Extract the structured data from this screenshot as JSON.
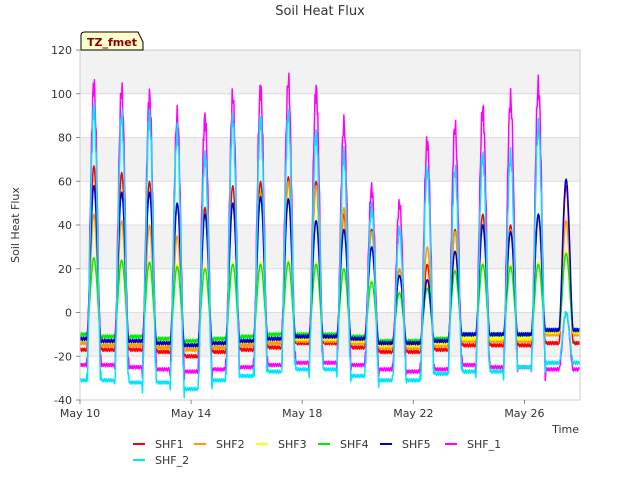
{
  "chart_data": {
    "type": "line",
    "title": "Soil Heat Flux",
    "xlabel": "Time",
    "ylabel": "Soil Heat Flux",
    "badge": "TZ_fmet",
    "xlim": [
      "2025-05-10",
      "2025-05-28"
    ],
    "ylim": [
      -40,
      120
    ],
    "yticks": [
      -40,
      -20,
      0,
      20,
      40,
      60,
      80,
      100,
      120
    ],
    "xticks": [
      {
        "date": "2025-05-10",
        "label": "May 10"
      },
      {
        "date": "2025-05-14",
        "label": "May 14"
      },
      {
        "date": "2025-05-18",
        "label": "May 18"
      },
      {
        "date": "2025-05-22",
        "label": "May 22"
      },
      {
        "date": "2025-05-26",
        "label": "May 26"
      }
    ],
    "grid": true,
    "legend_position": "bottom",
    "days": [
      "2025-05-10",
      "2025-05-11",
      "2025-05-12",
      "2025-05-13",
      "2025-05-14",
      "2025-05-15",
      "2025-05-16",
      "2025-05-17",
      "2025-05-18",
      "2025-05-19",
      "2025-05-20",
      "2025-05-21",
      "2025-05-22",
      "2025-05-23",
      "2025-05-24",
      "2025-05-25",
      "2025-05-26",
      "2025-05-27"
    ],
    "series": [
      {
        "name": "SHF1",
        "color": "#ff0000",
        "daily_max": [
          67,
          64,
          60,
          50,
          48,
          58,
          60,
          62,
          60,
          45,
          38,
          20,
          22,
          38,
          45,
          40,
          45,
          58
        ],
        "daily_min": [
          -17,
          -17,
          -17,
          -18,
          -20,
          -18,
          -17,
          -16,
          -14,
          -14,
          -16,
          -18,
          -18,
          -17,
          -15,
          -15,
          -15,
          -14
        ]
      },
      {
        "name": "SHF2",
        "color": "#ff9900",
        "daily_max": [
          45,
          42,
          40,
          35,
          45,
          50,
          55,
          60,
          58,
          48,
          37,
          20,
          30,
          37,
          40,
          38,
          43,
          42
        ],
        "daily_min": [
          -14,
          -15,
          -15,
          -16,
          -17,
          -16,
          -15,
          -14,
          -13,
          -13,
          -14,
          -16,
          -16,
          -15,
          -13,
          -13,
          -13,
          -10
        ]
      },
      {
        "name": "SHF3",
        "color": "#ffff00",
        "daily_max": [
          25,
          24,
          23,
          22,
          21,
          23,
          23,
          24,
          23,
          20,
          15,
          10,
          12,
          20,
          23,
          22,
          23,
          28
        ],
        "daily_min": [
          -12,
          -13,
          -13,
          -14,
          -15,
          -14,
          -13,
          -12,
          -12,
          -12,
          -13,
          -15,
          -15,
          -14,
          -12,
          -12,
          -12,
          -9
        ]
      },
      {
        "name": "SHF4",
        "color": "#00ee00",
        "daily_max": [
          25,
          24,
          23,
          21,
          20,
          22,
          22,
          23,
          22,
          20,
          14,
          9,
          11,
          19,
          22,
          21,
          22,
          27
        ],
        "daily_min": [
          -10,
          -11,
          -11,
          -12,
          -13,
          -12,
          -11,
          -10,
          -10,
          -10,
          -11,
          -13,
          -13,
          -12,
          -10,
          -10,
          -10,
          -8
        ]
      },
      {
        "name": "SHF5",
        "color": "#0000cc",
        "daily_max": [
          58,
          55,
          55,
          50,
          45,
          50,
          53,
          52,
          42,
          38,
          30,
          17,
          15,
          28,
          40,
          37,
          45,
          61
        ],
        "daily_min": [
          -12,
          -13,
          -13,
          -14,
          -15,
          -14,
          -13,
          -12,
          -11,
          -11,
          -12,
          -14,
          -14,
          -13,
          -10,
          -10,
          -10,
          -8
        ]
      },
      {
        "name": "SHF_1",
        "color": "#ff00ff",
        "daily_max": [
          104,
          102,
          99,
          90,
          89,
          99,
          102,
          106,
          102,
          86,
          57,
          50,
          78,
          85,
          93,
          98,
          104,
          0
        ],
        "daily_min": [
          -24,
          -24,
          -25,
          -26,
          -27,
          -26,
          -25,
          -24,
          -23,
          -23,
          -24,
          -26,
          -27,
          -26,
          -24,
          -25,
          -25,
          -26
        ]
      },
      {
        "name": "SHF_2",
        "color": "#00e5ff",
        "daily_max": [
          93,
          90,
          90,
          82,
          72,
          88,
          88,
          90,
          82,
          72,
          48,
          38,
          65,
          65,
          72,
          72,
          85,
          0
        ],
        "daily_min": [
          -31,
          -31,
          -32,
          -32,
          -35,
          -31,
          -29,
          -27,
          -26,
          -26,
          -29,
          -31,
          -31,
          -28,
          -27,
          -27,
          -25,
          -23
        ]
      }
    ]
  }
}
